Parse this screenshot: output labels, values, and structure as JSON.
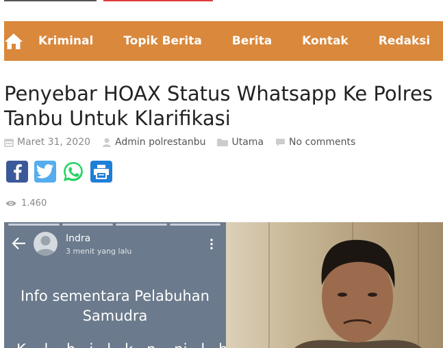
{
  "nav": {
    "items": [
      "Kriminal",
      "Topik Berita",
      "Berita",
      "Kontak",
      "Redaksi"
    ]
  },
  "post": {
    "title": "Penyebar HOAX Status Whatsapp Ke Polres Tanbu Untuk Klarifikasi",
    "date": "Maret 31, 2020",
    "author": "Admin polrestanbu",
    "category": "Utama",
    "comments": "No comments",
    "views": "1.460"
  },
  "share": [
    "facebook",
    "twitter",
    "whatsapp",
    "print"
  ],
  "media": {
    "contact_name": "Indra",
    "contact_time": "3 menit yang lalu",
    "message_line1": "Info sementara Pelabuhan",
    "message_line2": "Samudra",
    "message_line3": "K... l... h...i...l...k...n ...ni...l...h"
  },
  "colors": {
    "nav_bg": "#d9883c",
    "facebook": "#3b5998",
    "twitter": "#55acee",
    "whatsapp": "#25d366",
    "print": "#1e7fd6"
  }
}
